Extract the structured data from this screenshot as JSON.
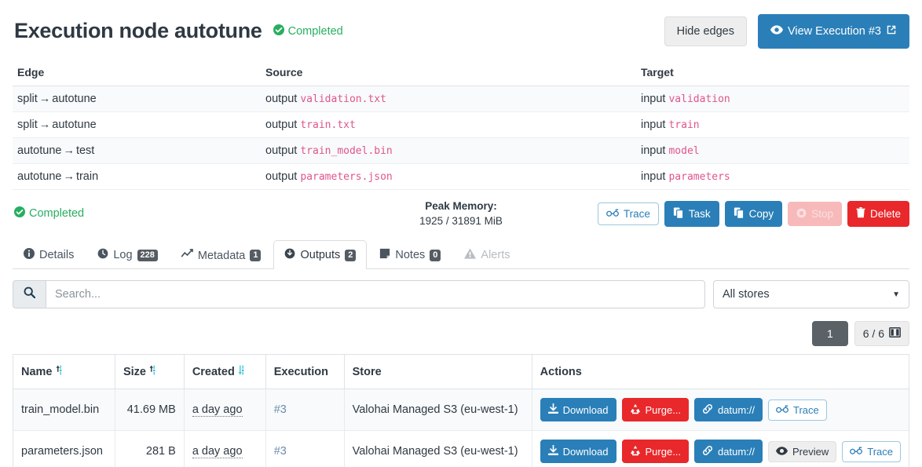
{
  "header": {
    "title": "Execution node autotune",
    "status": "Completed",
    "status_color": "#27ae60",
    "hide_edges_label": "Hide edges",
    "view_execution_label": "View Execution #3",
    "eye_icon": "eye-icon",
    "external_link_icon": "external-link-icon"
  },
  "edges_table": {
    "columns": [
      "Edge",
      "Source",
      "Target"
    ],
    "rows": [
      {
        "edge_from": "split",
        "edge_to": "autotune",
        "source_kind": "output",
        "source_name": "validation.txt",
        "target_kind": "input",
        "target_name": "validation"
      },
      {
        "edge_from": "split",
        "edge_to": "autotune",
        "source_kind": "output",
        "source_name": "train.txt",
        "target_kind": "input",
        "target_name": "train"
      },
      {
        "edge_from": "autotune",
        "edge_to": "test",
        "source_kind": "output",
        "source_name": "train_model.bin",
        "target_kind": "input",
        "target_name": "model"
      },
      {
        "edge_from": "autotune",
        "edge_to": "train",
        "source_kind": "output",
        "source_name": "parameters.json",
        "target_kind": "input",
        "target_name": "parameters"
      }
    ]
  },
  "statusbar": {
    "status": "Completed",
    "peak_memory_label": "Peak Memory:",
    "peak_memory_value": "1925 / 31891 MiB",
    "actions": [
      {
        "label": "Trace",
        "icon": "trace-icon",
        "style": "outline",
        "disabled": false
      },
      {
        "label": "Task",
        "icon": "copy-icon",
        "style": "primary",
        "disabled": false
      },
      {
        "label": "Copy",
        "icon": "copy-icon",
        "style": "primary",
        "disabled": false
      },
      {
        "label": "Stop",
        "icon": "stop-icon",
        "style": "danger-soft",
        "disabled": true
      },
      {
        "label": "Delete",
        "icon": "trash-icon",
        "style": "danger",
        "disabled": false
      }
    ]
  },
  "tabs": [
    {
      "label": "Details",
      "icon": "info-icon",
      "badge": null,
      "active": false,
      "disabled": false
    },
    {
      "label": "Log",
      "icon": "clock-icon",
      "badge": "228",
      "active": false,
      "disabled": false
    },
    {
      "label": "Metadata",
      "icon": "chart-icon",
      "badge": "1",
      "active": false,
      "disabled": false
    },
    {
      "label": "Outputs",
      "icon": "download-circle-icon",
      "badge": "2",
      "active": true,
      "disabled": false
    },
    {
      "label": "Notes",
      "icon": "note-icon",
      "badge": "0",
      "active": false,
      "disabled": false
    },
    {
      "label": "Alerts",
      "icon": "warning-icon",
      "badge": null,
      "active": false,
      "disabled": true
    }
  ],
  "filters": {
    "search_placeholder": "Search...",
    "search_value": "",
    "search_icon": "search-icon",
    "store_selected": "All stores"
  },
  "pager": {
    "current_page": "1",
    "count_label": "6 / 6",
    "columns_icon": "columns-icon"
  },
  "outputs_table": {
    "columns": [
      {
        "label": "Name",
        "sort": "inactive"
      },
      {
        "label": "Size",
        "sort": "inactive"
      },
      {
        "label": "Created",
        "sort": "desc"
      },
      {
        "label": "Execution",
        "sort": null
      },
      {
        "label": "Store",
        "sort": null
      },
      {
        "label": "Actions",
        "sort": null
      }
    ],
    "rows": [
      {
        "name": "train_model.bin",
        "size": "41.69 MB",
        "created": "a day ago",
        "execution": "#3",
        "store": "Valohai Managed S3 (eu-west-1)",
        "actions": [
          {
            "label": "Download",
            "icon": "download-icon",
            "style": "primary"
          },
          {
            "label": "Purge...",
            "icon": "recycle-icon",
            "style": "danger"
          },
          {
            "label": "datum://",
            "icon": "link-icon",
            "style": "primary"
          },
          {
            "label": "Trace",
            "icon": "trace-icon",
            "style": "outline"
          }
        ]
      },
      {
        "name": "parameters.json",
        "size": "281 B",
        "created": "a day ago",
        "execution": "#3",
        "store": "Valohai Managed S3 (eu-west-1)",
        "actions": [
          {
            "label": "Download",
            "icon": "download-icon",
            "style": "primary"
          },
          {
            "label": "Purge...",
            "icon": "recycle-icon",
            "style": "danger"
          },
          {
            "label": "datum://",
            "icon": "link-icon",
            "style": "primary"
          },
          {
            "label": "Preview",
            "icon": "eye-icon",
            "style": "grey"
          },
          {
            "label": "Trace",
            "icon": "trace-icon",
            "style": "outline"
          }
        ]
      }
    ]
  },
  "colors": {
    "primary": "#2a7fb8",
    "danger": "#e8282b",
    "success": "#27ae60",
    "mono_pink": "#e0558b",
    "sort_active": "#3fc5de"
  }
}
